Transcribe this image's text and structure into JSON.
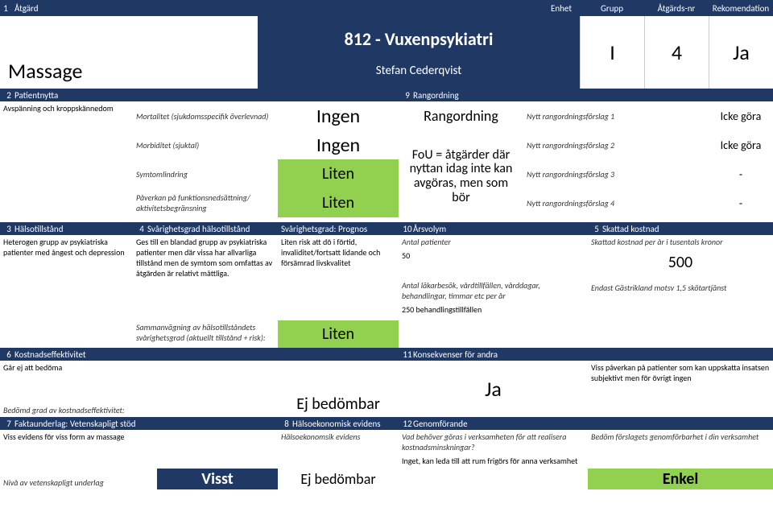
{
  "header": {
    "c1": "1",
    "atgard": "Åtgärd",
    "enhet": "Enhet",
    "grupp": "Grupp",
    "atgardsnr": "Åtgärds-nr",
    "rekomendation": "Rekomendation"
  },
  "top": {
    "massage": "Massage",
    "unit": "812 - Vuxenpsykiatri",
    "author": "Stefan Cederqvist",
    "grupp": "I",
    "nr": "4",
    "rek": "Ja"
  },
  "s2": {
    "num": "2",
    "title": "Patientnytta",
    "desc": "Avspänning och kroppskännedom",
    "r1l": "Mortalitet (sjukdomsspecifik överlevnad)",
    "r1v": "Ingen",
    "r2l": "Morbiditet (sjuktal)",
    "r2v": "Ingen",
    "r3l": "Symtomlindring",
    "r3v": "Liten",
    "r4l": "Påverkan på funktionsnedsättning/ aktivitetsbegränsning",
    "r4v": "Liten"
  },
  "s9": {
    "num": "9",
    "title": "Rangordning",
    "rangordning": "Rangordning",
    "fou": "FoU = åtgärder där nyttan idag inte kan avgöras, men som bör",
    "l1": "Nytt rangordningsförslag 1",
    "v1": "Icke göra",
    "l2": "Nytt rangordningsförslag 2",
    "v2": "Icke göra",
    "l3": "Nytt rangordningsförslag 3",
    "v3": "-",
    "l4": "Nytt rangordningsförslag 4",
    "v4": "-"
  },
  "s3": {
    "num": "3",
    "title": "Hälsotillstånd",
    "desc": "Heterogen grupp av psykiatriska patienter med ångest och depression"
  },
  "s4": {
    "num": "4",
    "title": "Svårighetsgrad hälsotillstånd",
    "desc": "Ges till en blandad grupp av psykiatriska patienter men där vissa har allvarliga tillstånd men de symtom som omfattas av åtgärden är relativt måttliga.",
    "sumlabel": "Sammanvägning av hälsotillståndets svårighetsgrad (aktuellt tillstånd + risk):"
  },
  "s4b": {
    "title": "Svårighetsgrad: Prognos",
    "desc": "Liten risk att dö i förtid, invaliditet/fortsatt lidande och försämrad livskvalitet",
    "sumval": "Liten"
  },
  "s10": {
    "num": "10",
    "title": "Årsvolym",
    "ap": "Antal patienter",
    "apv": "50",
    "lb": "Antal läkarbesök, vårdtillfällen, vårddagar, behandlingar, timmar etc per år",
    "lbv": "250 behandlingstillfällen"
  },
  "s5": {
    "num": "5",
    "title": "Skattad kostnad",
    "desc": "Skattad kostnad per år i tusentals kronor",
    "val": "500",
    "note": "Endast Gästrikland motsv 1,5 skötartjänst"
  },
  "s6": {
    "num": "6",
    "title": "Kostnadseffektivitet",
    "desc": "Går ej att bedöma",
    "label": "Bedömd grad av kostnadseffektivitet:",
    "val": "Ej bedömbar"
  },
  "s11": {
    "num": "11",
    "title": "Konsekvenser för andra",
    "val": "Ja",
    "note": "Viss påverkan på patienter som kan uppskatta insatsen subjektivt men för övrigt ingen"
  },
  "s7": {
    "num": "7",
    "title": "Faktaunderlag: Vetenskapligt stöd",
    "desc": "Viss evidens för viss form av massage",
    "label": "Nivå av vetenskapligt underlag",
    "val": "Visst"
  },
  "s8": {
    "num": "8",
    "title": "Hälsoekonomisk evidens",
    "desc": "Hälsoekonomsik evidens",
    "val": "Ej bedömbar"
  },
  "s12": {
    "num": "12",
    "title": "Genomförande",
    "q": "Vad behöver göras i verksamheten för att realisera kostnadsminskningar?",
    "a": "Inget, kan leda till att rum frigörs för anna verksamhet",
    "note": "Bedöm förslagets genomförbarhet i din verksamhet",
    "val": "Enkel"
  }
}
